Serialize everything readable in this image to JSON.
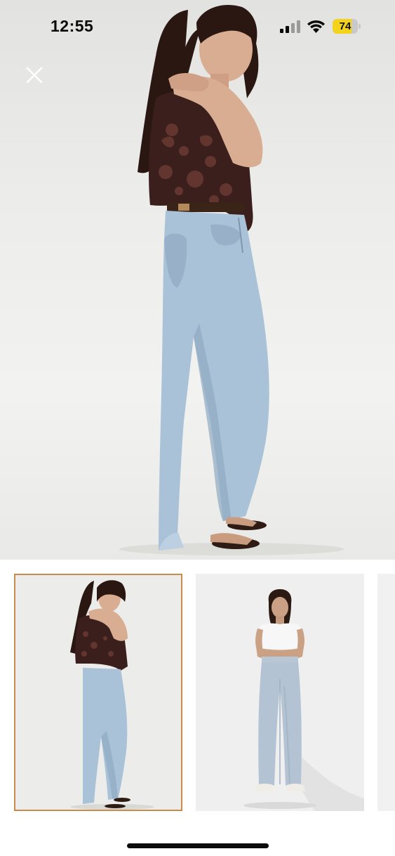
{
  "status_bar": {
    "time": "12:55",
    "battery_level": "74",
    "battery_fraction": 0.74,
    "battery_color": "#f4d31d",
    "icons": [
      "cellular-signal-icon",
      "wifi-icon",
      "battery-icon"
    ]
  },
  "header": {
    "close_icon": "close-icon"
  },
  "gallery": {
    "hero_image": "model-side-view-wide-leg-jeans-photo",
    "thumbnails": [
      {
        "image": "model-side-view-thumbnail",
        "selected": true
      },
      {
        "image": "model-front-view-thumbnail",
        "selected": false
      },
      {
        "image": "partial-next-thumbnail",
        "selected": false
      }
    ],
    "selected_border_color": "#c98a4b"
  },
  "colors": {
    "denim": "#a9c2d8",
    "vest": "#3b1f1c",
    "hair": "#2a1712",
    "skin": "#d9ad92"
  }
}
